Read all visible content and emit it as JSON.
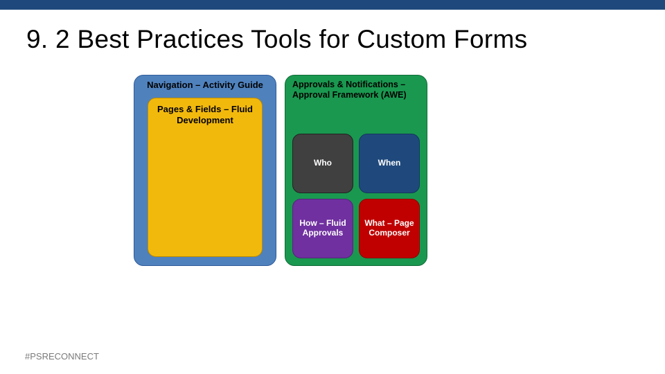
{
  "title": "9. 2 Best Practices Tools for Custom Forms",
  "left": {
    "nav_header": "Navigation – Activity Guide",
    "pages_header": "Pages & Fields – Fluid Development"
  },
  "right": {
    "approvals_header": "Approvals & Notifications – Approval Framework (AWE)",
    "cells": {
      "who": "Who",
      "when": "When",
      "how": "How – Fluid Approvals",
      "what": "What – Page Composer"
    }
  },
  "footer": "#PSRECONNECT",
  "colors": {
    "topbar": "#1f497d",
    "left_box": "#4f81bd",
    "inner_pages": "#f2b90d",
    "right_box": "#1a9850",
    "who": "#404040",
    "when": "#1f497d",
    "how": "#7030a0",
    "what": "#c00000"
  }
}
